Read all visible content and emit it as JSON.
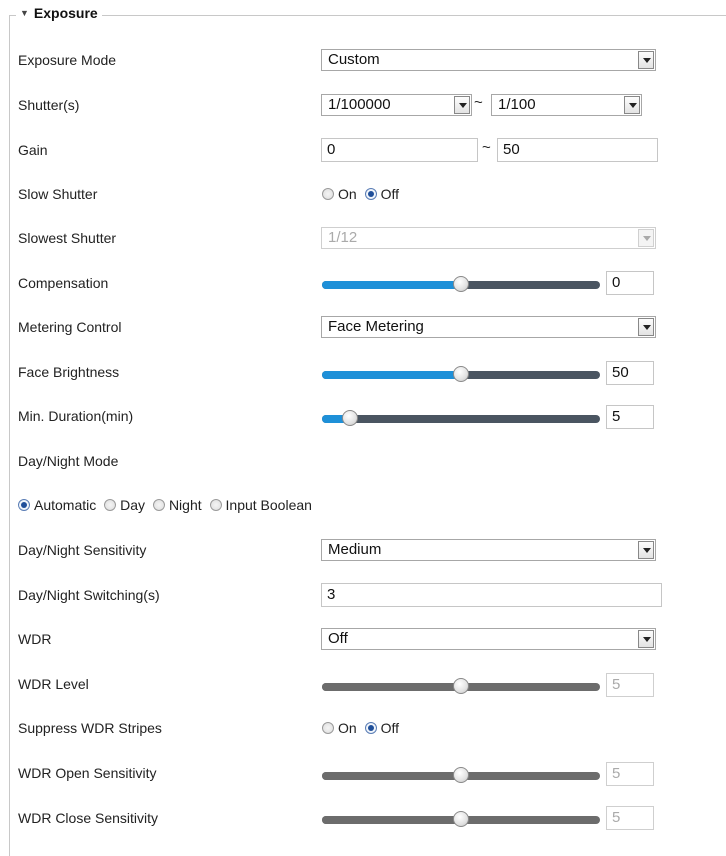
{
  "section": {
    "title": "Exposure"
  },
  "rows": {
    "exposure_mode": {
      "label": "Exposure Mode",
      "value": "Custom"
    },
    "shutter": {
      "label": "Shutter(s)",
      "min": "1/100000",
      "max": "1/100",
      "sep": "~"
    },
    "gain": {
      "label": "Gain",
      "min": "0",
      "max": "50",
      "sep": "~"
    },
    "slow_shutter": {
      "label": "Slow Shutter",
      "on": "On",
      "off": "Off",
      "selected": "Off"
    },
    "slowest_shutter": {
      "label": "Slowest Shutter",
      "value": "1/12"
    },
    "compensation": {
      "label": "Compensation",
      "value": "0",
      "level": 0.5
    },
    "metering_control": {
      "label": "Metering Control",
      "value": "Face Metering"
    },
    "face_brightness": {
      "label": "Face Brightness",
      "value": "50",
      "level": 0.5
    },
    "min_duration": {
      "label": "Min. Duration(min)",
      "value": "5",
      "level": 0.1
    },
    "day_night_mode": {
      "label": "Day/Night Mode",
      "options": [
        "Automatic",
        "Day",
        "Night",
        "Input Boolean"
      ],
      "selected": "Automatic"
    },
    "day_night_sensitivity": {
      "label": "Day/Night Sensitivity",
      "value": "Medium"
    },
    "day_night_switching": {
      "label": "Day/Night Switching(s)",
      "value": "3"
    },
    "wdr": {
      "label": "WDR",
      "value": "Off"
    },
    "wdr_level": {
      "label": "WDR Level",
      "value": "5",
      "level": 0.5
    },
    "suppress_wdr_stripes": {
      "label": "Suppress WDR Stripes",
      "on": "On",
      "off": "Off",
      "selected": "Off"
    },
    "wdr_open_sensitivity": {
      "label": "WDR Open Sensitivity",
      "value": "5",
      "level": 0.5
    },
    "wdr_close_sensitivity": {
      "label": "WDR Close Sensitivity",
      "value": "5",
      "level": 0.5
    }
  },
  "colors": {
    "slider_fill": "#1e90d8",
    "slider_track": "#4a5561",
    "radio_selected": "#1f4f9a"
  }
}
